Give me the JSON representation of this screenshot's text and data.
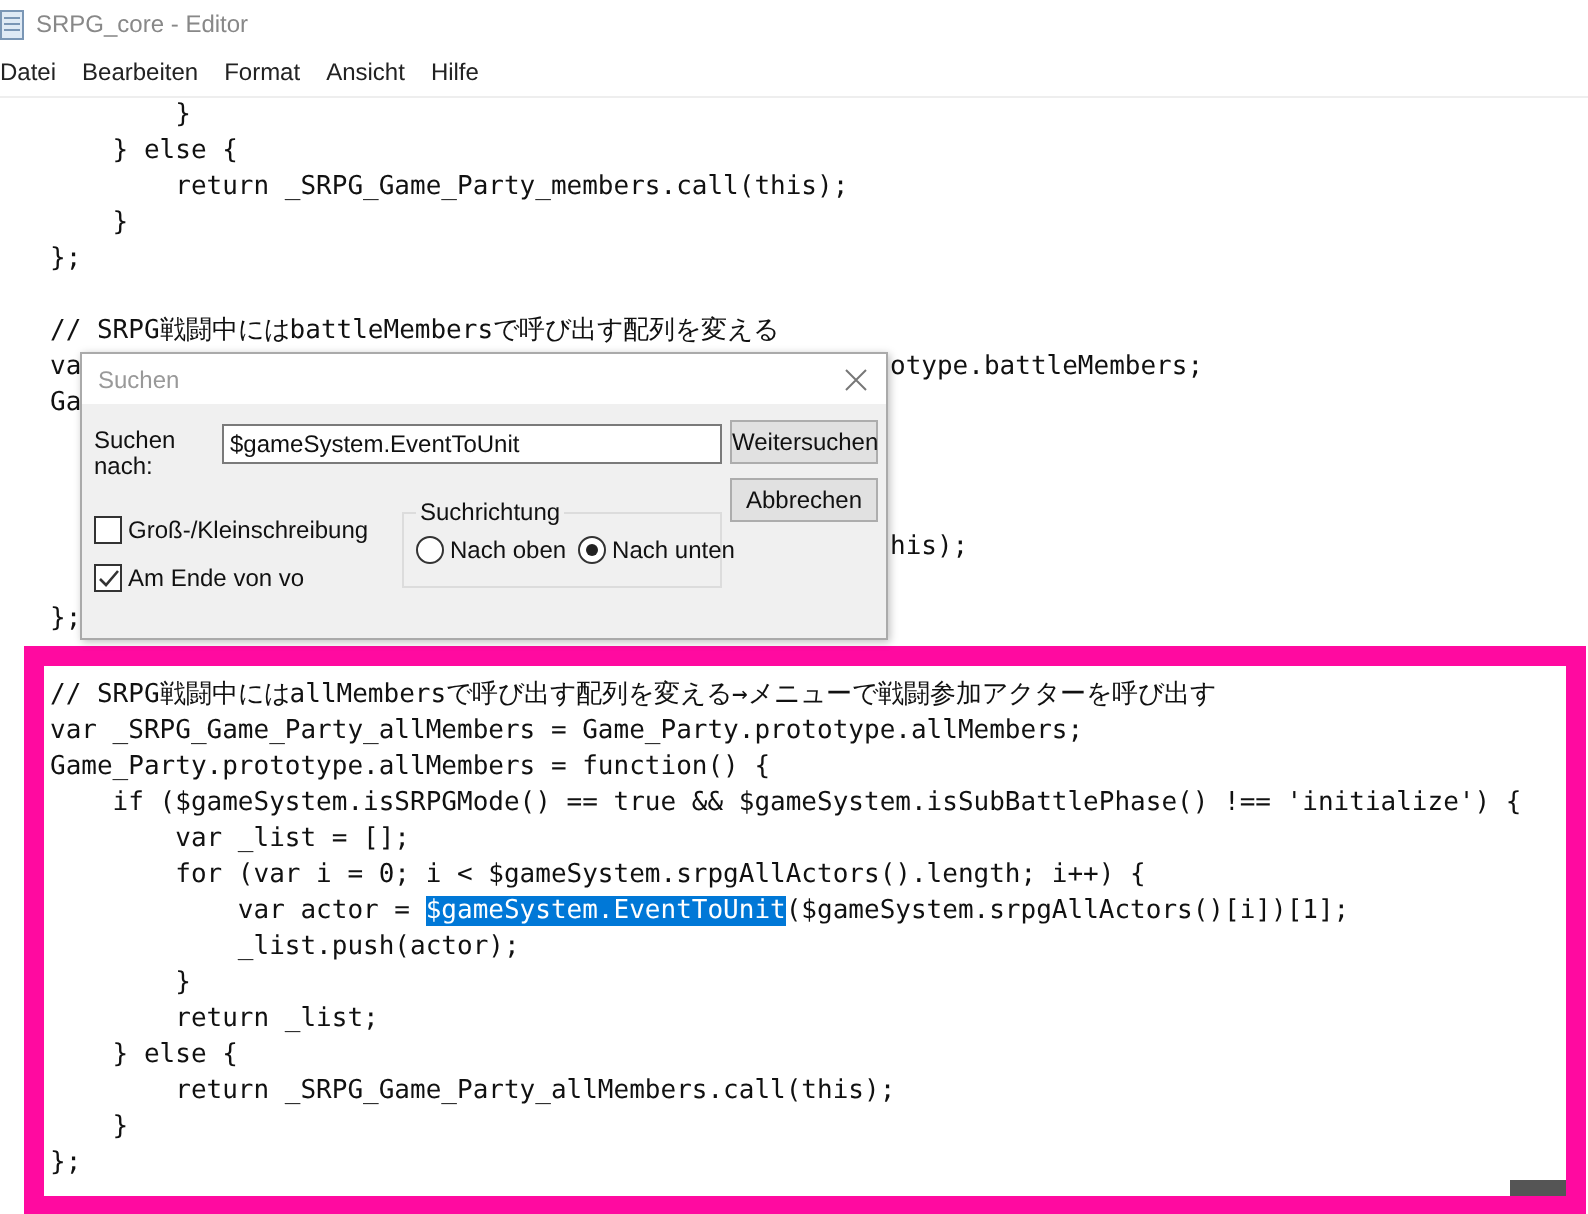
{
  "window": {
    "title": "SRPG_core - Editor"
  },
  "menu": [
    "Datei",
    "Bearbeiten",
    "Format",
    "Ansicht",
    "Hilfe"
  ],
  "editor": {
    "lines": [
      {
        "kind": "text",
        "text": "        }"
      },
      {
        "kind": "text",
        "text": "    } else {"
      },
      {
        "kind": "text",
        "text": "        return _SRPG_Game_Party_members.call(this);"
      },
      {
        "kind": "text",
        "text": "    }"
      },
      {
        "kind": "text",
        "text": "};"
      },
      {
        "kind": "blank"
      },
      {
        "kind": "text",
        "text": "// SRPG戦闘中にはbattleMembersで呼び出す配列を変える"
      },
      {
        "kind": "clipped",
        "left": "va",
        "right": "otype.battleMembers;"
      },
      {
        "kind": "clipped",
        "left": "Ga"
      },
      {
        "kind": "blank"
      },
      {
        "kind": "blank"
      },
      {
        "kind": "blank"
      },
      {
        "kind": "clipped",
        "right": "his);"
      },
      {
        "kind": "blank"
      },
      {
        "kind": "text",
        "text": "};"
      }
    ]
  },
  "highlight_box": {
    "lines": [
      {
        "kind": "text",
        "text": "// SRPG戦闘中にはallMembersで呼び出す配列を変える→メニューで戦闘参加アクターを呼び出す"
      },
      {
        "kind": "text",
        "text": "var _SRPG_Game_Party_allMembers = Game_Party.prototype.allMembers;"
      },
      {
        "kind": "text",
        "text": "Game_Party.prototype.allMembers = function() {"
      },
      {
        "kind": "text",
        "text": "    if ($gameSystem.isSRPGMode() == true && $gameSystem.isSubBattlePhase() !== 'initialize') {"
      },
      {
        "kind": "text",
        "text": "        var _list = [];"
      },
      {
        "kind": "text",
        "text": "        for (var i = 0; i < $gameSystem.srpgAllActors().length; i++) {"
      },
      {
        "kind": "selection",
        "before": "            var actor = ",
        "selected": "$gameSystem.EventToUnit",
        "after": "($gameSystem.srpgAllActors()[i])[1];"
      },
      {
        "kind": "text",
        "text": "            _list.push(actor);"
      },
      {
        "kind": "text",
        "text": "        }"
      },
      {
        "kind": "text",
        "text": "        return _list;"
      },
      {
        "kind": "text",
        "text": "    } else {"
      },
      {
        "kind": "text",
        "text": "        return _SRPG_Game_Party_allMembers.call(this);"
      },
      {
        "kind": "text",
        "text": "    }"
      },
      {
        "kind": "text",
        "text": "};"
      }
    ]
  },
  "find_dialog": {
    "title": "Suchen",
    "label": "Suchen nach:",
    "value": "$gameSystem.EventToUnit",
    "buttons": [
      "Weitersuchen",
      "Abbrechen"
    ],
    "direction": {
      "label": "Suchrichtung",
      "options": [
        {
          "label": "Nach oben",
          "selected": false
        },
        {
          "label": "Nach unten",
          "selected": true
        }
      ]
    },
    "checkboxes": [
      {
        "label": "Groß-/Kleinschreibung",
        "checked": false
      },
      {
        "label": "Am Ende von vo",
        "checked": true
      }
    ]
  }
}
